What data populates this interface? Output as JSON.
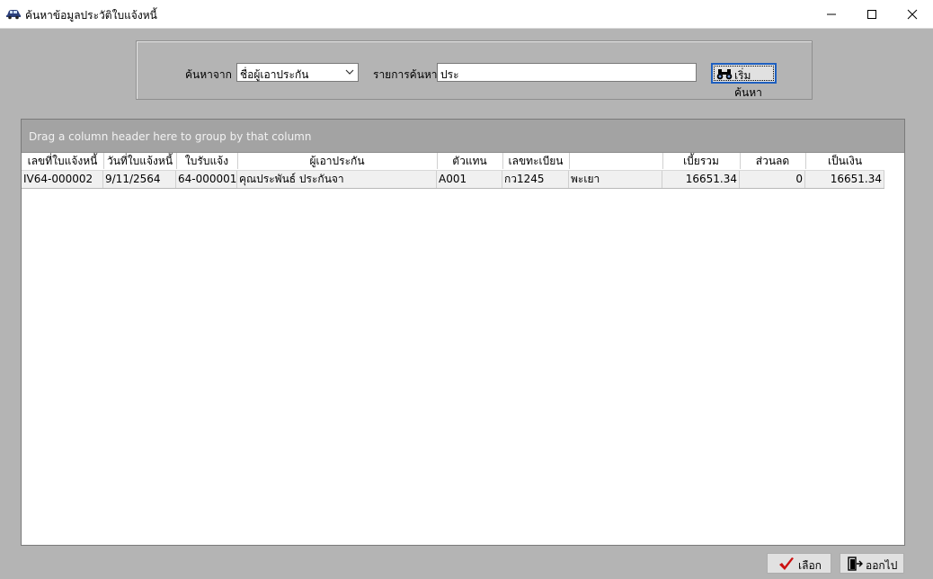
{
  "window": {
    "title": "ค้นหาข้อมูลประวัติใบแจ้งหนี้",
    "icons": [
      "car-icon",
      "minimize-icon",
      "maximize-icon",
      "close-icon"
    ]
  },
  "search": {
    "from_label": "ค้นหาจาก",
    "from_value": "ชื่อผู้เอาประกัน",
    "keyword_label": "รายการค้นหา",
    "keyword_value": "ประ",
    "button_label": "เริ่มค้นหา"
  },
  "grid": {
    "group_hint": "Drag a column header here to group by that column",
    "columns": [
      "เลขที่ใบแจ้งหนี้",
      "วันที่ใบแจ้งหนี้",
      "ใบรับแจ้ง",
      "ผู้เอาประกัน",
      "ตัวแทน",
      "เลขทะเบียน",
      "",
      "เบี้ยรวม",
      "ส่วนลด",
      "เป็นเงิน"
    ],
    "rows": [
      [
        "IV64-000002",
        "9/11/2564",
        "64-000001",
        "คุณประพันธ์ ประกันจา",
        "A001",
        "กว1245",
        "พะเยา",
        "16651.34",
        "0",
        "16651.34"
      ]
    ]
  },
  "footer": {
    "select_label": "เลือก",
    "exit_label": "ออกไป"
  },
  "colors": {
    "background": "#b4b4b4",
    "group_panel": "#a3a3a3",
    "focus_border": "#1e5fbf",
    "check_red": "#cc1111"
  }
}
